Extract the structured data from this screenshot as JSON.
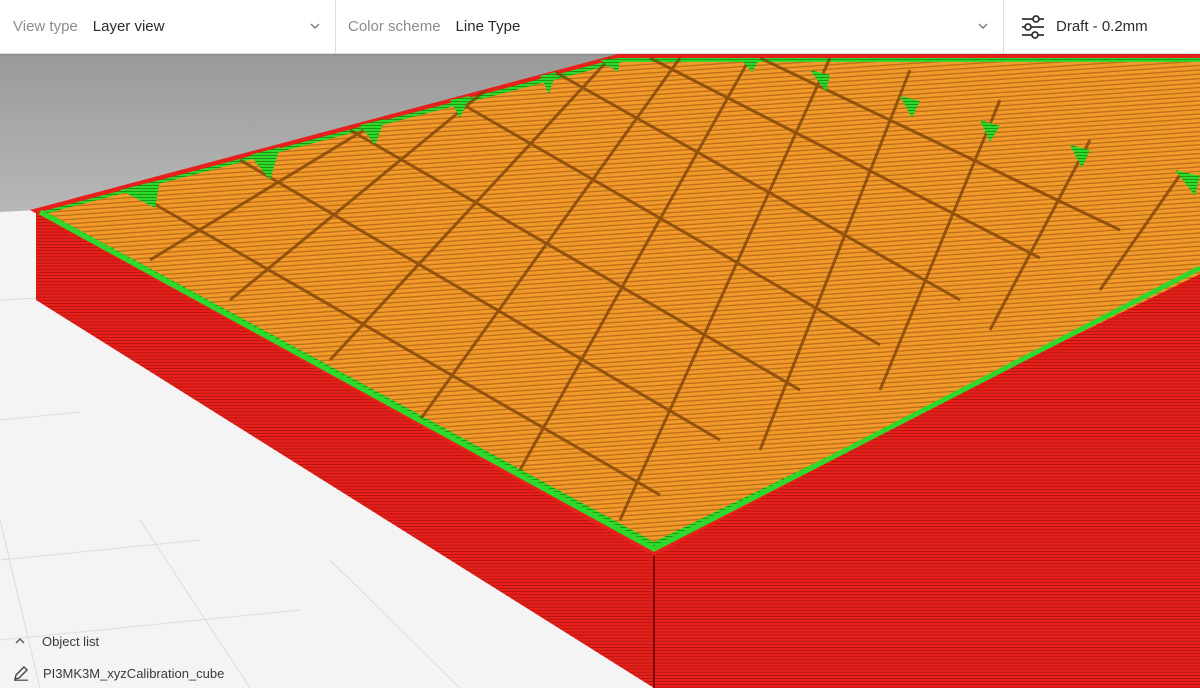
{
  "toolbar": {
    "view_type": {
      "caption": "View type",
      "value": "Layer view"
    },
    "color_scheme": {
      "caption": "Color scheme",
      "value": "Line Type"
    },
    "print_setup": {
      "label": "Draft - 0.2mm"
    }
  },
  "object_list": {
    "title": "Object list",
    "items": [
      {
        "name": "PI3MK3M_xyzCalibration_cube"
      }
    ]
  },
  "colors": {
    "wall_outer": "#e8201b",
    "wall_inner": "#2fd92b",
    "infill": "#f39a2a",
    "background": "#f4f4f4",
    "toolbar_bg": "#ffffff"
  },
  "icons": {
    "view_type_dropdown": "chevron-down-icon",
    "color_scheme_dropdown": "chevron-down-icon",
    "print_setup": "sliders-icon",
    "object_list_toggle": "caret-up-icon",
    "object_item": "pencil-icon"
  }
}
